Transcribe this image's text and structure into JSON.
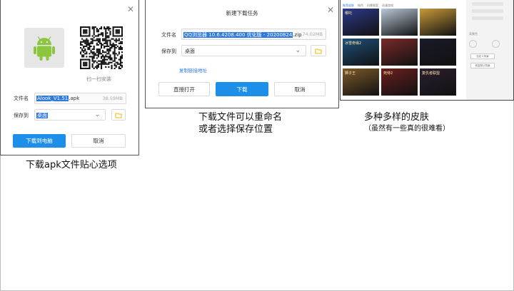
{
  "apk_dialog": {
    "qr_caption": "扫一扫安装",
    "filename_label": "文件名",
    "filename_selected": "Alook_V1.51",
    "filename_ext": ".apk",
    "file_size": "38.59MB",
    "saveto_label": "保存到",
    "saveto_value": "桌面",
    "download_button": "下载到电脑",
    "cancel_button": "取消",
    "android_color": "#8cc63f"
  },
  "new_download_dialog": {
    "title": "新建下载任务",
    "filename_label": "文件名",
    "filename_selected": "QQ浏览器 10.6.4208.400 优化版 - 20200824",
    "filename_ext": ".zip",
    "file_size": "74.02MB",
    "saveto_label": "保存到",
    "saveto_value": "桌面",
    "copy_link": "复制链接地址",
    "open_button": "直接打开",
    "download_button": "下载",
    "cancel_button": "取消"
  },
  "skin_panel": {
    "tabs": [
      "推荐皮肤",
      "纯色",
      "风景图案",
      "动漫游戏"
    ],
    "side_label": "背景色",
    "side_buttons": [
      "自定义背景",
      "恢复默认背景"
    ],
    "swatches": [
      "#ffffff",
      "#000000",
      "#ffffff"
    ],
    "posters": [
      {
        "title": "哪吒",
        "color": "#2c3a8a"
      },
      {
        "title": "",
        "color": "#b9c7d8"
      },
      {
        "title": "",
        "color": "#c79a3a"
      },
      {
        "title": "冰雪奇缘2",
        "color": "#1f4f7a"
      },
      {
        "title": "",
        "color": "#7a2a2a"
      },
      {
        "title": "",
        "color": "#1a1a2a"
      },
      {
        "title": "狮子王",
        "color": "#7a5a2a"
      },
      {
        "title": "死侍2",
        "color": "#6a1f1f"
      },
      {
        "title": "复仇者联盟",
        "color": "#2a2030"
      }
    ]
  },
  "captions": {
    "apk": "下载apk文件贴心选项",
    "rename_line1": "下载文件可以重命名",
    "rename_line2": "或者选择保存位置",
    "skins_main": "多种多样的皮肤",
    "skins_note": "（虽然有一些真的很难看）"
  },
  "colors": {
    "primary": "#1e8fe8",
    "selection": "#2f7ae0",
    "folder": "#f5b800"
  }
}
